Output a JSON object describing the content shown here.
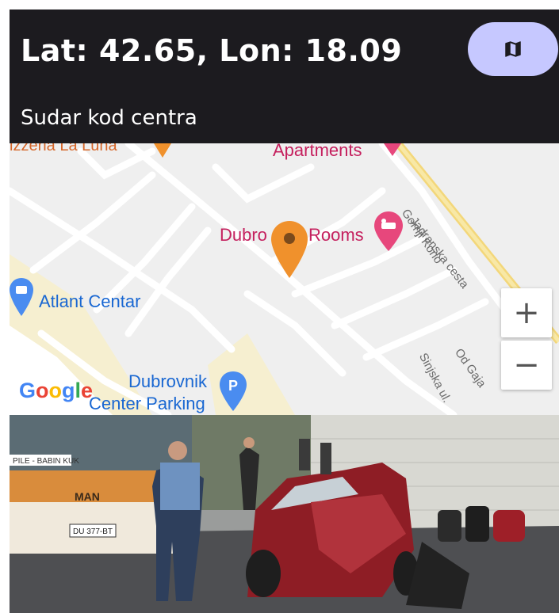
{
  "header": {
    "coordinates": "Lat: 42.65, Lon: 18.09",
    "title": "Sudar kod centra",
    "map_button_icon": "map-icon"
  },
  "map": {
    "labels": {
      "top_left": "izzeria La Luna",
      "apartments": "Apartments",
      "rooms_left": "Dubro",
      "rooms_right": "Rooms",
      "jadranska": "Jadranska cesta",
      "gornji": "Gornji Kono",
      "atlant": "Atlant Centar",
      "sinjska": "Sinjska ul.",
      "od_gaja": "Od Gaja",
      "parking_1": "Dubrovnik",
      "parking_2": "Center Parking"
    },
    "zoom_in": "+",
    "zoom_out": "−",
    "logo": "Google",
    "marker_color": "#f0912c"
  },
  "photo": {
    "description_icon": "accident-photo",
    "bus_sign": "PILE - BABIN KUK",
    "bus_brand": "MAN",
    "bus_plate": "DU 377-BT"
  }
}
